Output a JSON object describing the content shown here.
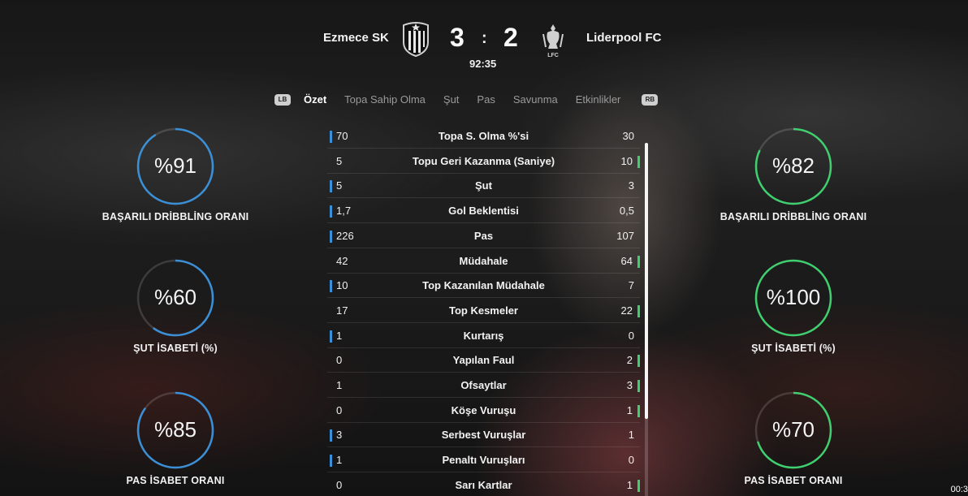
{
  "match": {
    "home_team": "Ezmece SK",
    "away_team": "Liderpool FC",
    "home_score": "3",
    "away_score": "2",
    "separator": ":",
    "time": "92:35",
    "away_crest_text": "LFC"
  },
  "tabs": {
    "left_bumper": "LB",
    "right_bumper": "RB",
    "items": [
      "Özet",
      "Topa Sahip Olma",
      "Şut",
      "Pas",
      "Savunma",
      "Etkinlikler"
    ],
    "active": "Özet"
  },
  "home_rings": [
    {
      "value": "%91",
      "label": "BAŞARILI DRİBBLİNG ORANI",
      "fill": 0.91
    },
    {
      "value": "%60",
      "label": "ŞUT İSABETİ (%)",
      "fill": 0.6
    },
    {
      "value": "%85",
      "label": "PAS İSABET ORANI",
      "fill": 0.85
    }
  ],
  "away_rings": [
    {
      "value": "%82",
      "label": "BAŞARILI DRİBBLİNG ORANI",
      "fill": 0.82
    },
    {
      "value": "%100",
      "label": "ŞUT İSABETİ (%)",
      "fill": 1.0
    },
    {
      "value": "%70",
      "label": "PAS İSABET ORANI",
      "fill": 0.7
    }
  ],
  "colors": {
    "home": "#3b8fd6",
    "away": "#3fcf6f",
    "ring_track": "rgba(255,255,255,0.15)"
  },
  "stats": [
    {
      "label": "Topa S. Olma %'si",
      "home": "70",
      "away": "30",
      "leader": "home"
    },
    {
      "label": "Topu Geri Kazanma (Saniye)",
      "home": "5",
      "away": "10",
      "leader": "away"
    },
    {
      "label": "Şut",
      "home": "5",
      "away": "3",
      "leader": "home"
    },
    {
      "label": "Gol Beklentisi",
      "home": "1,7",
      "away": "0,5",
      "leader": "home"
    },
    {
      "label": "Pas",
      "home": "226",
      "away": "107",
      "leader": "home"
    },
    {
      "label": "Müdahale",
      "home": "42",
      "away": "64",
      "leader": "away"
    },
    {
      "label": "Top Kazanılan Müdahale",
      "home": "10",
      "away": "7",
      "leader": "home"
    },
    {
      "label": "Top Kesmeler",
      "home": "17",
      "away": "22",
      "leader": "away"
    },
    {
      "label": "Kurtarış",
      "home": "1",
      "away": "0",
      "leader": "home"
    },
    {
      "label": "Yapılan Faul",
      "home": "0",
      "away": "2",
      "leader": "away"
    },
    {
      "label": "Ofsaytlar",
      "home": "1",
      "away": "3",
      "leader": "away"
    },
    {
      "label": "Köşe Vuruşu",
      "home": "0",
      "away": "1",
      "leader": "away"
    },
    {
      "label": "Serbest Vuruşlar",
      "home": "3",
      "away": "1",
      "leader": "home"
    },
    {
      "label": "Penaltı Vuruşları",
      "home": "1",
      "away": "0",
      "leader": "home"
    },
    {
      "label": "Sarı Kartlar",
      "home": "0",
      "away": "1",
      "leader": "away"
    }
  ],
  "corner_clock": "00:3"
}
